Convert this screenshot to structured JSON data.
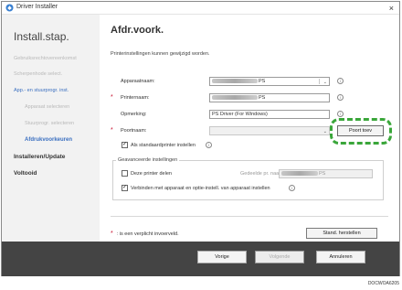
{
  "window": {
    "title": "Driver Installer",
    "close_symbol": "×"
  },
  "sidebar": {
    "title": "Install.stap.",
    "items": [
      {
        "label": "Gebruiksrechtovereenkomst",
        "state": "done"
      },
      {
        "label": "Scherpenhode select.",
        "state": "done"
      },
      {
        "label": "App.- en stuurprogr. inst.",
        "state": "active"
      },
      {
        "label": "Apparaat selecteren",
        "state": "done"
      },
      {
        "label": "Stuurprogr. selecteren",
        "state": "done"
      },
      {
        "label": "Afdrukvoorkeuren",
        "state": "current"
      },
      {
        "label": "Installeren/Update",
        "state": "upcoming"
      },
      {
        "label": "Voltooid",
        "state": "upcoming"
      }
    ]
  },
  "main": {
    "title": "Afdr.voork.",
    "intro": "Printerinstellingen kunnen gewijzigd worden.",
    "fields": {
      "device_name": {
        "label": "Apparaatnaam:",
        "value_suffix": "PS",
        "required": false
      },
      "printer_name": {
        "label": "Printernaam:",
        "value_suffix": "PS",
        "required": true
      },
      "comment": {
        "label": "Opmerking:",
        "value": "PS Driver (For Windows)",
        "required": false
      },
      "port_name": {
        "label": "Poortnaam:",
        "value": "",
        "required": true
      }
    },
    "add_port_button": "Poort toev",
    "set_default": {
      "label": "Als standaardprinter instellen",
      "checked": true
    },
    "advanced": {
      "legend": "Geavanceerde instellingen",
      "share": {
        "label": "Deze printer delen",
        "checked": false
      },
      "share_name_label": "Gedeelde pr. naam:",
      "share_name_suffix": "PS",
      "connect": {
        "label": "Verbinden met apparaat en optie-instell. van apparaat instellen",
        "checked": true
      }
    },
    "required_note": ": is een verplicht invoerveld.",
    "required_star": "*",
    "reset_button": "Stand. herstellen"
  },
  "footer": {
    "back": "Vorige",
    "next": "Volgende",
    "cancel": "Annuleren"
  },
  "icons": {
    "info": "i",
    "checkmark": "✓",
    "dropdown": "⌄"
  },
  "doc_code": "DOCWOA6205",
  "colors": {
    "accent": "#3a6fc0",
    "required": "#c8102e",
    "highlight": "#3aa63a",
    "bottombar": "#444444"
  }
}
